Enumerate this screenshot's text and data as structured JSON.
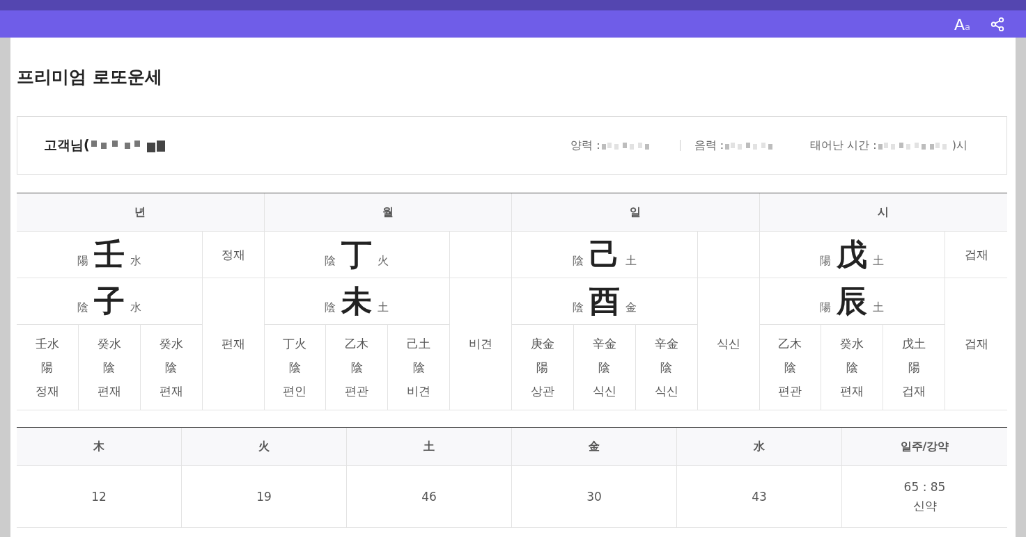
{
  "top_bar": {
    "font_button": {
      "label": "A",
      "sub": "a"
    }
  },
  "title": "프리미엄 로또운세",
  "customer": {
    "name_prefix": "고객님(",
    "solar_label": "양력 :",
    "lunar_label": "음력 :",
    "birth_time_label": "태어난 시간 :",
    "birth_time_suffix": ")시"
  },
  "pillars": [
    {
      "label": "년",
      "stem": {
        "char": "壬",
        "yinyang": "陽",
        "element": "水"
      },
      "stem_sipsin": "정재",
      "branch": {
        "char": "子",
        "yinyang": "陰",
        "element": "水"
      },
      "branch_sipsin": "편재",
      "hidden": [
        {
          "stem": "壬水",
          "yinyang": "陽",
          "sipsin": "정재"
        },
        {
          "stem": "癸水",
          "yinyang": "陰",
          "sipsin": "편재"
        },
        {
          "stem": "癸水",
          "yinyang": "陰",
          "sipsin": "편재"
        }
      ]
    },
    {
      "label": "월",
      "stem": {
        "char": "丁",
        "yinyang": "陰",
        "element": "火"
      },
      "branch": {
        "char": "未",
        "yinyang": "陰",
        "element": "土"
      },
      "branch_sipsin": "비견",
      "hidden": [
        {
          "stem": "丁火",
          "yinyang": "陰",
          "sipsin": "편인"
        },
        {
          "stem": "乙木",
          "yinyang": "陰",
          "sipsin": "편관"
        },
        {
          "stem": "己土",
          "yinyang": "陰",
          "sipsin": "비견"
        }
      ]
    },
    {
      "label": "일",
      "stem": {
        "char": "己",
        "yinyang": "陰",
        "element": "土"
      },
      "branch": {
        "char": "酉",
        "yinyang": "陰",
        "element": "金"
      },
      "branch_sipsin": "식신",
      "hidden": [
        {
          "stem": "庚金",
          "yinyang": "陽",
          "sipsin": "상관"
        },
        {
          "stem": "辛金",
          "yinyang": "陰",
          "sipsin": "식신"
        },
        {
          "stem": "辛金",
          "yinyang": "陰",
          "sipsin": "식신"
        }
      ]
    },
    {
      "label": "시",
      "stem": {
        "char": "戊",
        "yinyang": "陽",
        "element": "土"
      },
      "stem_sipsin": "겁재",
      "branch": {
        "char": "辰",
        "yinyang": "陽",
        "element": "土"
      },
      "branch_sipsin": "겁재",
      "hidden": [
        {
          "stem": "乙木",
          "yinyang": "陰",
          "sipsin": "편관"
        },
        {
          "stem": "癸水",
          "yinyang": "陰",
          "sipsin": "편재"
        },
        {
          "stem": "戊土",
          "yinyang": "陽",
          "sipsin": "겁재"
        }
      ]
    }
  ],
  "elements": {
    "columns": [
      "木",
      "火",
      "土",
      "金",
      "水",
      "일주/강약"
    ],
    "values": [
      "12",
      "19",
      "46",
      "30",
      "43"
    ],
    "strength": [
      "65 : 85",
      "신약"
    ]
  }
}
